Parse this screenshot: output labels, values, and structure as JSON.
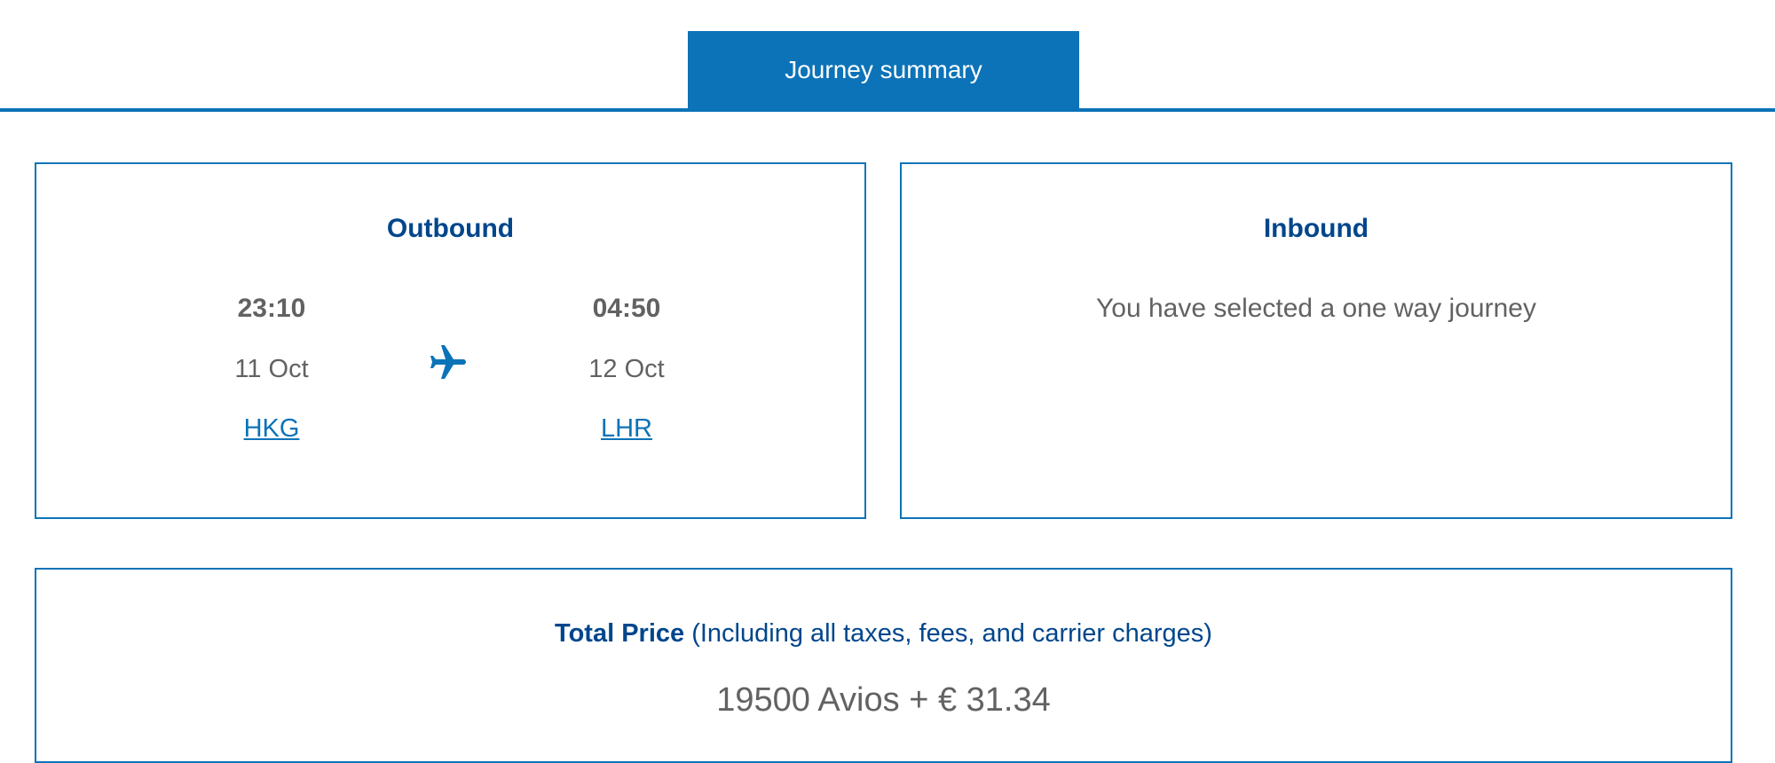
{
  "tabs": {
    "active_label": "Journey summary"
  },
  "outbound": {
    "title": "Outbound",
    "departure": {
      "time": "23:10",
      "date": "11 Oct",
      "airport_code": "HKG"
    },
    "arrival": {
      "time": "04:50",
      "date": "12 Oct",
      "airport_code": "LHR"
    },
    "icon": "plane-icon"
  },
  "inbound": {
    "title": "Inbound",
    "message": "You have selected a one way journey"
  },
  "price": {
    "label": "Total Price",
    "note": "(Including all taxes, fees, and carrier charges)",
    "value": "19500 Avios + € 31.34"
  },
  "colors": {
    "accent": "#0c73b8",
    "heading": "#00468c",
    "text": "#626262"
  }
}
